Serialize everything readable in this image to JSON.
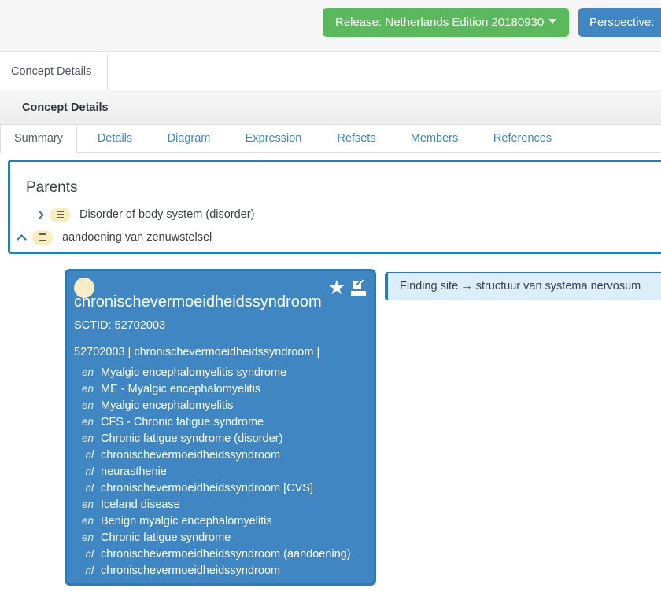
{
  "top_bar": {
    "release_button": "Release: Netherlands Edition 20180930",
    "release_caret_icon": "caret-down-icon",
    "release_color": "#5cb85c",
    "perspective_button": "Perspective:",
    "perspective_color": "#3f86c2"
  },
  "outer_tabs": [
    {
      "label": "Concept Details",
      "active": true
    }
  ],
  "section": {
    "title": "Concept Details"
  },
  "sub_tabs": [
    {
      "label": "Summary",
      "active": true
    },
    {
      "label": "Details",
      "active": false
    },
    {
      "label": "Diagram",
      "active": false
    },
    {
      "label": "Expression",
      "active": false
    },
    {
      "label": "Refsets",
      "active": false
    },
    {
      "label": "Members",
      "active": false
    },
    {
      "label": "References",
      "active": false
    }
  ],
  "parents": {
    "title": "Parents",
    "border_color": "#3079b5",
    "items": [
      {
        "label": "Disorder of body system (disorder)",
        "chevron_icon": "chevron-right-icon",
        "badge_icon": "hamburger-badge-icon"
      },
      {
        "label": "aandoening van zenuwstelsel",
        "chevron_icon": "chevron-up-icon",
        "badge_icon": "hamburger-badge-icon"
      }
    ]
  },
  "concept_card": {
    "background_color": "#3f86c2",
    "dot_color": "#f7eec7",
    "dot_icon": "concept-status-dot-icon",
    "star_icon": "star-icon",
    "star_glyph": "★",
    "export_icon": "export-icon",
    "fsn": "chronischevermoeidheidssyndroom",
    "sctid_label": "SCTID: 52702003",
    "id_line": "52702003 | chronischevermoeidheidssyndroom |",
    "descriptions": [
      {
        "lang": "en",
        "term": "Myalgic encephalomyelitis syndrome"
      },
      {
        "lang": "en",
        "term": "ME - Myalgic encephalomyelitis"
      },
      {
        "lang": "en",
        "term": "Myalgic encephalomyelitis"
      },
      {
        "lang": "en",
        "term": "CFS - Chronic fatigue syndrome"
      },
      {
        "lang": "en",
        "term": "Chronic fatigue syndrome (disorder)"
      },
      {
        "lang": "nl",
        "term": "chronischevermoeidheidssyndroom"
      },
      {
        "lang": "nl",
        "term": "neurasthenie"
      },
      {
        "lang": "nl",
        "term": "chronischevermoeidheidssyndroom [CVS]"
      },
      {
        "lang": "en",
        "term": "Iceland disease"
      },
      {
        "lang": "en",
        "term": "Benign myalgic encephalomyelitis"
      },
      {
        "lang": "en",
        "term": "Chronic fatigue syndrome"
      },
      {
        "lang": "nl",
        "term": "chronischevermoeidheidssyndroom (aandoening)"
      },
      {
        "lang": "nl",
        "term": "chronischevermoeidheidssyndroom"
      }
    ]
  },
  "relationship": {
    "text": "Finding site →  structuur van systema nervosum",
    "border_color": "#3079b5",
    "background_color": "#dceefa"
  }
}
